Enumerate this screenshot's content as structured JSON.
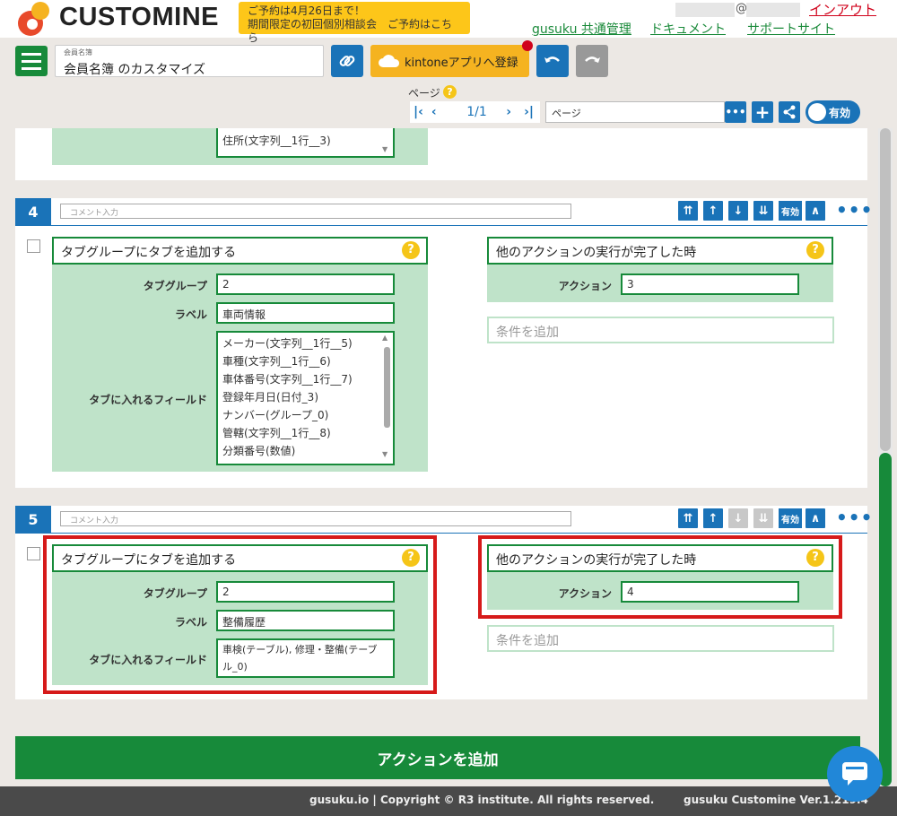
{
  "header": {
    "logo_text": "CUSTOMINE",
    "promo_line1": "ご予約は4月26日まで！",
    "promo_line2": "期間限定の初回個別相談会　ご予約はこちら",
    "user_at": "@",
    "logout": "インアウト",
    "links": [
      "gusuku 共通管理",
      "ドキュメント",
      "サポートサイト"
    ]
  },
  "toolbar": {
    "app_small_label": "会員名簿",
    "app_name": "会員名簿 のカスタマイズ",
    "kintone_button": "kintoneアプリへ登録",
    "page_label": "ページ",
    "page_number": "1/1",
    "page_name": "ページ",
    "toggle_label": "有効"
  },
  "colors": {
    "green": "#178a3a",
    "blue": "#1a73b8",
    "yellow": "#f5c518",
    "red": "#d61a1a",
    "mint": "#bfe3c9"
  },
  "step3": {
    "partial_items": [
      "住所(文字列__1行__3)"
    ]
  },
  "step4": {
    "number": "4",
    "comment_placeholder": "コメント入力",
    "enabled_label": "有効",
    "action": {
      "title": "タブグループにタブを追加する",
      "help": "?",
      "tab_group_label": "タブグループ",
      "tab_group_value": "2",
      "label_label": "ラベル",
      "label_value": "車両情報",
      "fields_label": "タブに入れるフィールド",
      "fields": [
        "メーカー(文字列__1行__5)",
        "車種(文字列__1行__6)",
        "車体番号(文字列__1行__7)",
        "登録年月日(日付_3)",
        "ナンバー(グループ_0)",
        "管轄(文字列__1行__8)",
        "分類番号(数値)"
      ]
    },
    "condition": {
      "title": "他のアクションの実行が完了した時",
      "help": "?",
      "action_label": "アクション",
      "action_value": "3",
      "add_condition": "条件を追加"
    }
  },
  "step5": {
    "number": "5",
    "comment_placeholder": "コメント入力",
    "enabled_label": "有効",
    "action": {
      "title": "タブグループにタブを追加する",
      "help": "?",
      "tab_group_label": "タブグループ",
      "tab_group_value": "2",
      "label_label": "ラベル",
      "label_value": "整備履歴",
      "fields_label": "タブに入れるフィールド",
      "fields_line1": "車検(テーブル), 修理・整備(テーブ",
      "fields_line2": "ル_0)"
    },
    "condition": {
      "title": "他のアクションの実行が完了した時",
      "help": "?",
      "action_label": "アクション",
      "action_value": "4",
      "add_condition": "条件を追加"
    }
  },
  "add_action_button": "アクションを追加",
  "footer": {
    "copyright": "gusuku.io | Copyright © R3 institute. All rights reserved.",
    "version": "gusuku Customine Ver.1.219.4"
  }
}
